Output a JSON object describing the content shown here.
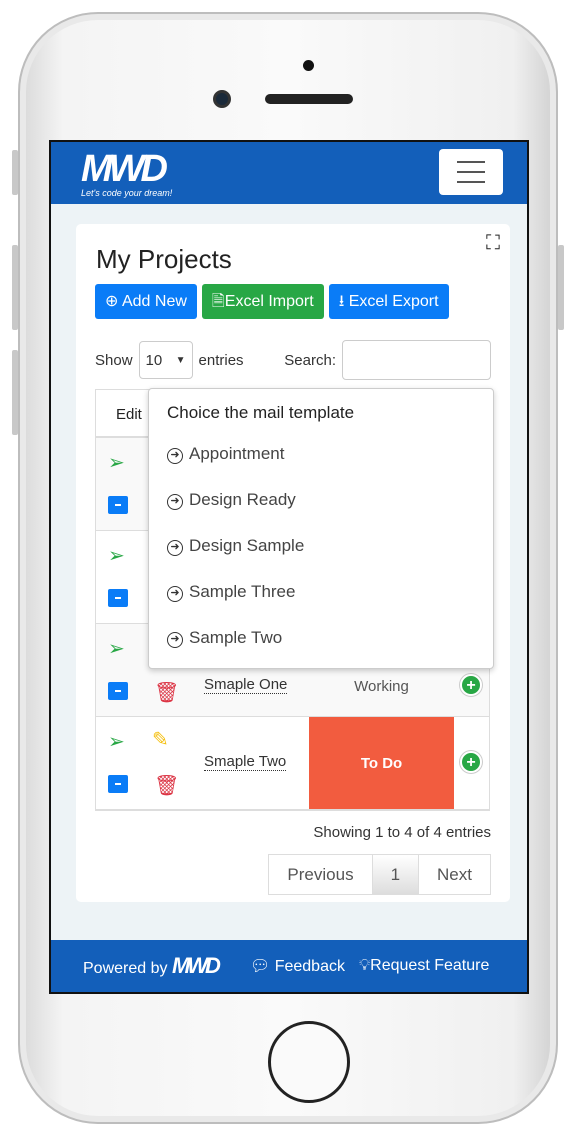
{
  "brand": {
    "logo": "MWD",
    "tagline": "Let's code your dream!"
  },
  "page": {
    "title": "My Projects"
  },
  "toolbar": {
    "add_new": "Add New",
    "excel_import": "Excel Import",
    "excel_export": "Excel Export"
  },
  "table_controls": {
    "show_label": "Show",
    "entries_value": "10",
    "entries_label": "entries",
    "search_label": "Search:",
    "search_value": ""
  },
  "table": {
    "header_edit": "Edit",
    "rows": [
      {
        "name": "",
        "status": ""
      },
      {
        "name": "",
        "status": ""
      },
      {
        "name": "Smaple One",
        "status": "Working"
      },
      {
        "name": "Smaple Two",
        "status": "To Do",
        "status_color": "#f25c3f"
      }
    ]
  },
  "dropdown": {
    "title": "Choice the mail template",
    "items": [
      "Appointment",
      "Design Ready",
      "Design Sample",
      "Sample Three",
      "Sample Two"
    ]
  },
  "footer_table": {
    "info": "Showing 1 to 4 of 4 entries",
    "previous": "Previous",
    "page": "1",
    "next": "Next"
  },
  "footer": {
    "powered_by": "Powered by",
    "logo": "MWD",
    "feedback": "Feedback",
    "request_feature": "Request Feature"
  },
  "colors": {
    "brand": "#135fba",
    "primary": "#0a7cf7",
    "success": "#28a745",
    "danger": "#dc3545"
  }
}
